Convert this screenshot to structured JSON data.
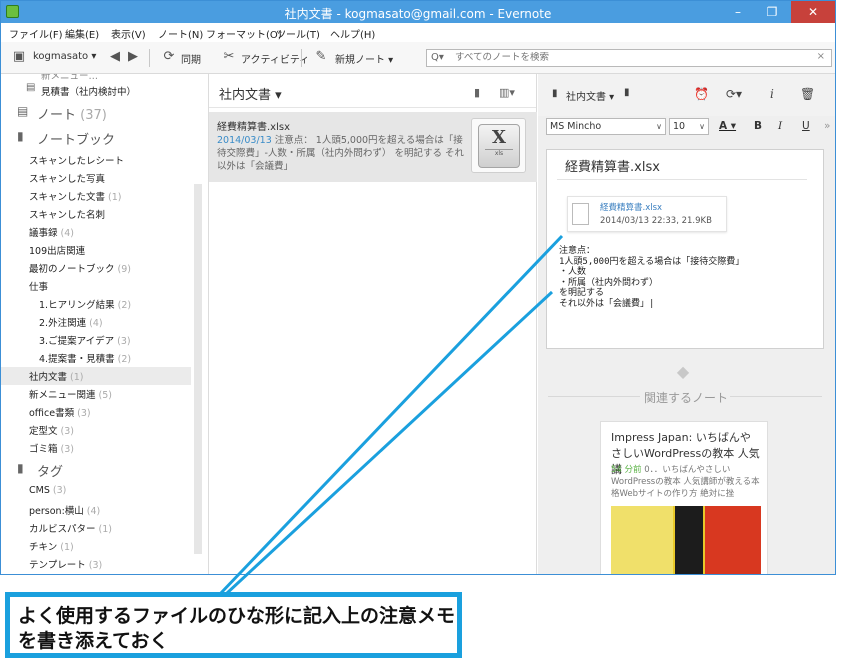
{
  "window": {
    "title": "社内文書 - kogmasato@gmail.com - Evernote",
    "min": "–",
    "max": "❐",
    "close": "✕"
  },
  "menu": [
    "ファイル(F)",
    "編集(E)",
    "表示(V)",
    "ノート(N)",
    "フォーマット(O)",
    "ツール(T)",
    "ヘルプ(H)"
  ],
  "toolbar": {
    "account": "kogmasato",
    "sync": "同期",
    "activity": "アクティビティ",
    "new_note": "新規ノート"
  },
  "search": {
    "placeholder": "すべてのノートを検索",
    "clear": "×"
  },
  "sidebar": {
    "partial_top": "新メニュー…",
    "estimate": "見積書（社内検討中）",
    "notes_label": "ノート",
    "notes_count": "(37)",
    "notebooks_label": "ノートブック",
    "notebooks": [
      {
        "label": "スキャンしたレシート",
        "count": ""
      },
      {
        "label": "スキャンした写真",
        "count": ""
      },
      {
        "label": "スキャンした文書",
        "count": "(1)"
      },
      {
        "label": "スキャンした名刺",
        "count": ""
      },
      {
        "label": "議事録",
        "count": "(4)"
      },
      {
        "label": "109出店関連",
        "count": ""
      },
      {
        "label": "最初のノートブック",
        "count": "(9)"
      },
      {
        "label": "仕事",
        "count": ""
      },
      {
        "label": "1.ヒアリング結果",
        "count": "(2)"
      },
      {
        "label": "2.外注関連",
        "count": "(4)"
      },
      {
        "label": "3.ご提案アイデア",
        "count": "(3)"
      },
      {
        "label": "4.提案書・見積書",
        "count": "(2)"
      },
      {
        "label": "社内文書",
        "count": "(1)"
      },
      {
        "label": "新メニュー関連",
        "count": "(5)"
      },
      {
        "label": "office書類",
        "count": "(3)"
      },
      {
        "label": "定型文",
        "count": "(3)"
      },
      {
        "label": "ゴミ箱",
        "count": "(3)"
      }
    ],
    "tags_label": "タグ",
    "tags": [
      {
        "label": "CMS",
        "count": "(3)"
      },
      {
        "label": "person:横山",
        "count": "(4)"
      },
      {
        "label": "カルビスパター",
        "count": "(1)"
      },
      {
        "label": "チキン",
        "count": "(1)"
      },
      {
        "label": "テンプレート",
        "count": "(3)"
      }
    ]
  },
  "notelist": {
    "header": "社内文書 ▾",
    "card": {
      "title": "経費精算書.xlsx",
      "date": "2014/03/13",
      "snippet": " 注意点： 1人頭5,000円を超える場合は「接待交際費」-人数・所属（社内外問わず） を明記する それ以外は「会議費」",
      "thumb_big": "X",
      "thumb_small": "xls"
    }
  },
  "editor": {
    "notebook": "社内文書 ▾",
    "font": "MS Mincho",
    "size": "10",
    "bold": "B",
    "italic": "I",
    "underline": "U",
    "title": "経費精算書.xlsx",
    "attachment_name": "経費精算書.xlsx",
    "attachment_meta": "2014/03/13 22:33, 21.9KB",
    "memo": "注意点：\n1人頭5,000円を超える場合は「接待交際費」\n・人数\n・所属（社内外問わず）\nを明記する\nそれ以外は「会議費」|",
    "related_label": "関連するノート",
    "related_title": "Impress Japan: いちばんやさしいWordPressの教本 人気講",
    "related_time": "54 分前",
    "related_snippet": " 0．．いちばんやさしいWordPressの教本 人気講師が教える本格Webサイトの作り方 絶対に挫"
  },
  "annotation": {
    "text": "よく使用するファイルのひな形に記入上の注意メモを書き添えておく"
  },
  "colors": {
    "accent": "#1aa0de",
    "titlebar": "#4a9de0",
    "date_blue": "#3a8cc8"
  }
}
